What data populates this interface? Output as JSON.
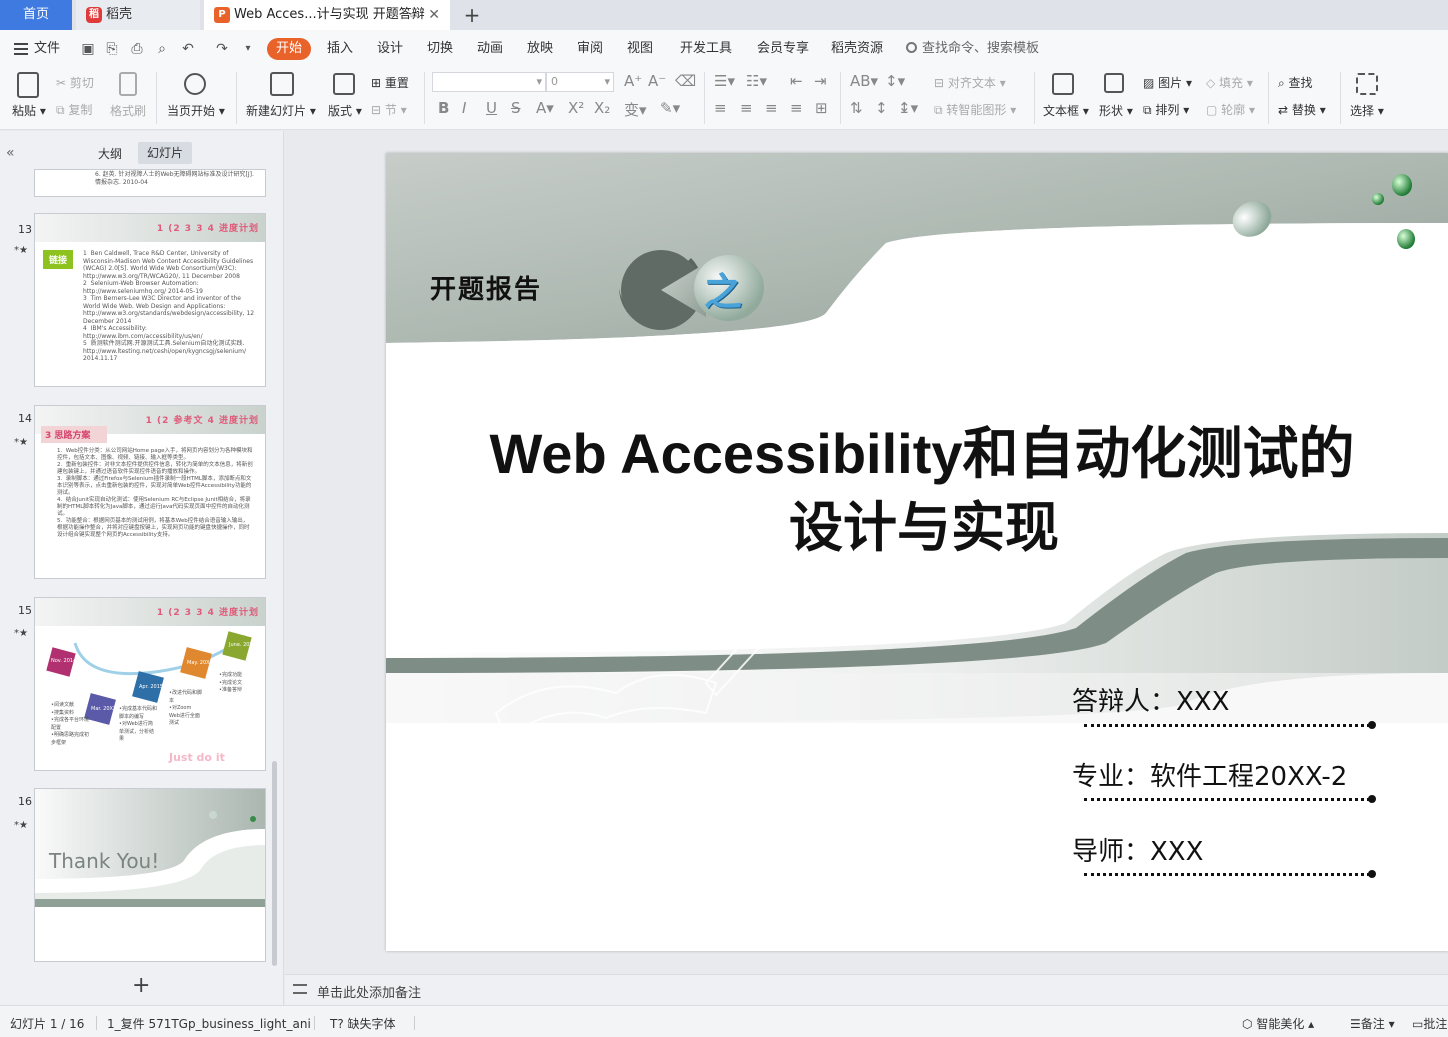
{
  "tabs": {
    "home": "首页",
    "wps": "稻壳",
    "doc_title": "Web Acces...计与实现 开题答辩",
    "add": "+"
  },
  "menu": {
    "file": "文件",
    "items": [
      "开始",
      "插入",
      "设计",
      "切换",
      "动画",
      "放映",
      "审阅",
      "视图",
      "开发工具",
      "会员专享",
      "稻壳资源"
    ],
    "search": "查找命令、搜索模板"
  },
  "ribbon": {
    "paste": "粘贴",
    "cut": "剪切",
    "copy": "复制",
    "format_painter": "格式刷",
    "play_from_current": "当页开始",
    "new_slide": "新建幻灯片",
    "layout": "版式",
    "reset": "重置",
    "section": "节",
    "font_name": "",
    "font_size": "0",
    "align_text": "对齐文本",
    "convert_smartart": "转智能图形",
    "textbox": "文本框",
    "shape": "形状",
    "picture": "图片",
    "arrange": "排列",
    "fill": "填充",
    "outline": "轮廓",
    "find": "查找",
    "replace": "替换",
    "select": "选择"
  },
  "panel": {
    "outline_tab": "大纲",
    "slides_tab": "幻灯片",
    "collapse": "«",
    "add": "+",
    "slide_numbers": [
      "13",
      "14",
      "15",
      "16"
    ],
    "thumb12_text": "6.  赵英. 针对视障人士的Web无障碍网站标准及设计研究[J]. 情报杂志. 2010-04",
    "thumb13_steps": "1 (2 3 3 4 进度计划",
    "thumb13_tag": "链接",
    "thumb13_text": "1  Ben Caldwell, Trace R&D Center, University of Wisconsin-Madison Web Content Accessibility Guidelines (WCAG) 2.0[S]. World Wide Web Consortium(W3C): http://www.w3.org/TR/WCAG20/, 11 December 2008\n2  Selenium-Web Browser Automation: http://www.seleniumhq.org/ 2014-05-19\n3  Tim Berners-Lee W3C Director and inventor of the World Wide Web. Web Design and Applications: http://www.w3.org/standards/webdesign/accessibility, 12 December 2014\n4  IBM's Accessibility: http://www.ibm.com/accessibility/us/en/\n5  质测软件测试网.开源测试工具.Selenium自动化测试实践. http://www.ltesting.net/ceshi/open/kygncsgj/selenium/ 2014.11.17",
    "thumb14_steps": "1 (2 参考文 4 进度计划",
    "thumb14_tag": "3 思路方案",
    "thumb14_text": "1.  Web控件分类：从公司网站Home page入手，将网页内容划分为各种模块和控件，包括文本、图像、视频、链接、输入框等类型。\n2.  重新包装控件：对非文本控件提供控件信息，转化为简单的文本信息，将新创建包装键上，并通过语音软件实现控件语音的播放和操作。\n3.  录制脚本：通过Firefox与Selenium插件录制一段HTML脚本，添加断点和文本识别等表示，点击重新包装的控件，实现对简单Web控件Accessibility功能的测试。\n4.  结合Junit实现自动化测试：使用Selenium RC与Eclipse Junit相结合，将录制的HTML脚本转化为Java脚本，通过运行Java代码实现页面中控件的自动化测试。\n5.  功能整合：根据网页基本的测试用例，将基本Web控件结合语音输入输出，根据功能操作整合，并将对应键盘按键上，实现网页功能的键盘快捷操作，同时设计组合键实现整个网页的Accessibility支持。",
    "thumb15_steps": "1 (2 3 3 4 进度计划",
    "thumb15_months": [
      "Nov. 2014",
      "Mar. 20XX",
      "Apr. 2015",
      "May. 20X",
      "June. 20X"
    ],
    "thumb15_col1": "•阅读文献\n•搜集资料\n•完成各平台环境配置\n•明确思路完成初步框架",
    "thumb15_col2": "•完成基本代码和脚本的编写\n•对Web进行简单测试，分析结果",
    "thumb15_col3": "•改进代码和脚本\n•对Zoom Web进行全面测试",
    "thumb15_col4": "•完成功能\n•完成论文\n•准备答辩",
    "thumb15_motto": "Just do it",
    "thumb16_text": "Thank You!"
  },
  "slide": {
    "report_label": "开题报告",
    "emblem_char": "之",
    "title_line1": "Web Accessibility和自动化测试的",
    "title_line2": "设计与实现",
    "defender": "答辩人：XXX",
    "major": "专业：软件工程20XX-2",
    "advisor": "导师：XXX"
  },
  "notes": {
    "placeholder": "单击此处添加备注"
  },
  "status": {
    "slide_count": "幻灯片 1 / 16",
    "theme": "1_复件 571TGp_business_light_ani",
    "missing_font": "缺失字体",
    "beautify": "智能美化",
    "notes": "备注",
    "comment": "批注"
  }
}
